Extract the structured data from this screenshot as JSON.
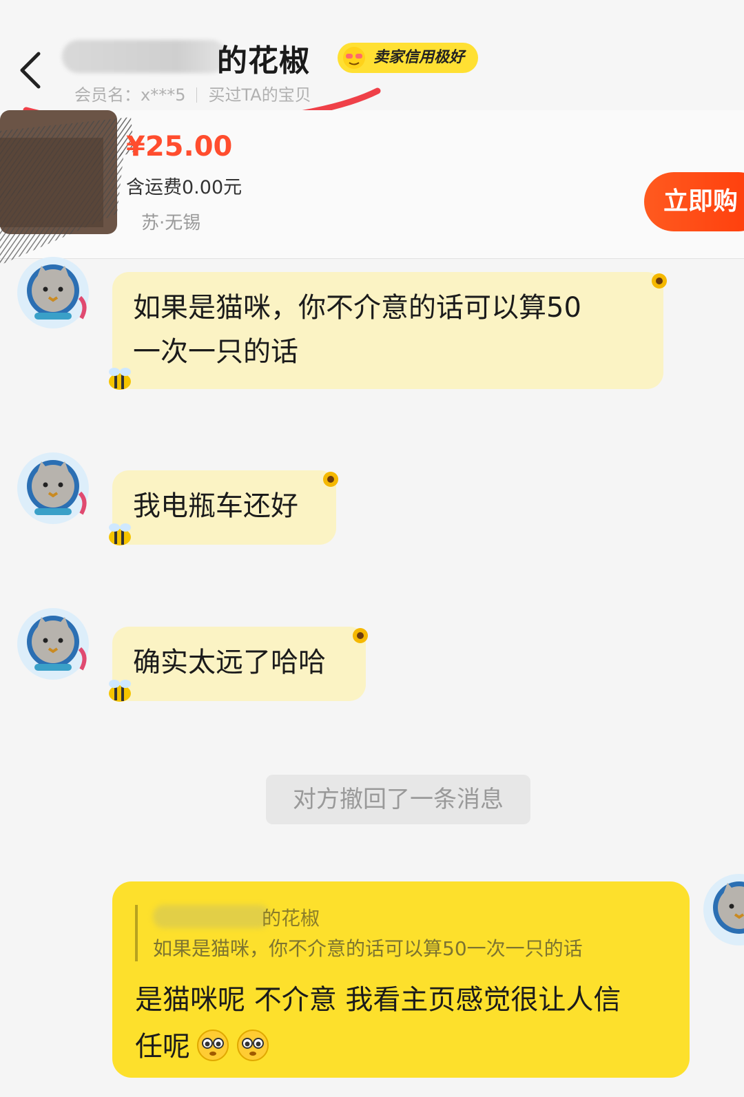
{
  "header": {
    "seller_name_visible": "的花椒",
    "credit_badge": "卖家信用极好",
    "member_label": "会员名：",
    "member_value": "x***5",
    "bought_label": "买过TA的宝贝"
  },
  "product": {
    "price": "¥25.00",
    "shipping": "含运费0.00元",
    "location": "苏·无锡",
    "buy_button": "立即购"
  },
  "messages": [
    {
      "from": "seller",
      "text_line1": "如果是猫咪，你不介意的话可以算50",
      "text_line2": "一次一只的话"
    },
    {
      "from": "seller",
      "text": "我电瓶车还好"
    },
    {
      "from": "seller",
      "text": "确实太远了哈哈"
    }
  ],
  "recall_notice": "对方撤回了一条消息",
  "reply": {
    "quote_name_visible": "的花椒",
    "quote_text": "如果是猫咪，你不介意的话可以算50一次一只的话",
    "text_line1": "是猫咪呢 不介意 我看主页感觉很让人信",
    "text_line2": "任呢"
  },
  "colors": {
    "accent_yellow": "#fde02c",
    "incoming_bubble": "#fbf3c4",
    "price_red": "#ff4d2e",
    "buy_orange": "#ff4a14"
  },
  "icons": [
    "back-arrow-icon",
    "wink-face-icon",
    "cat-avatar-icon",
    "sunflower-icon",
    "bee-icon",
    "pleading-face-icon"
  ]
}
